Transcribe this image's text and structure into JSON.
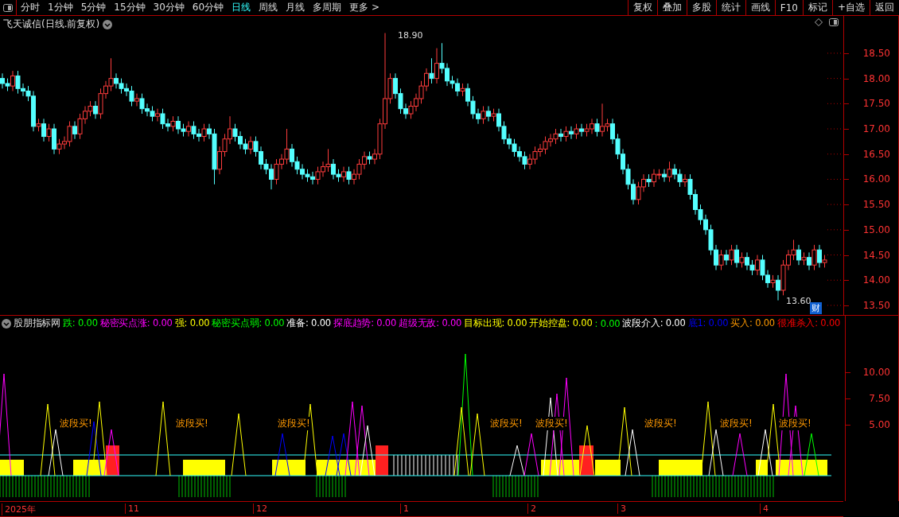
{
  "toolbar": {
    "periods": [
      {
        "label": "分时",
        "selected": false
      },
      {
        "label": "1分钟",
        "selected": false
      },
      {
        "label": "5分钟",
        "selected": false
      },
      {
        "label": "15分钟",
        "selected": false
      },
      {
        "label": "30分钟",
        "selected": false
      },
      {
        "label": "60分钟",
        "selected": false
      },
      {
        "label": "日线",
        "selected": true
      },
      {
        "label": "周线",
        "selected": false
      },
      {
        "label": "月线",
        "selected": false
      },
      {
        "label": "多周期",
        "selected": false
      },
      {
        "label": "更多 >",
        "selected": false
      }
    ],
    "actions": [
      "复权",
      "叠加",
      "多股",
      "统计",
      "画线",
      "F10",
      "标记",
      "+自选",
      "返回"
    ]
  },
  "price_chart": {
    "title": "飞天诚信(日线.前复权)",
    "high_label": "18.90",
    "low_label": "13.60",
    "badge": "财",
    "chart_data": {
      "type": "candlestick",
      "ylim": [
        13.31,
        19.24
      ],
      "yticks": [
        {
          "value": 18.5,
          "label": "18.50"
        },
        {
          "value": 18,
          "label": "18.00"
        },
        {
          "value": 17.5,
          "label": "17.50"
        },
        {
          "value": 17,
          "label": "17.00"
        },
        {
          "value": 16.5,
          "label": "16.50"
        },
        {
          "value": 16,
          "label": "16.00"
        },
        {
          "value": 15.5,
          "label": "15.50"
        },
        {
          "value": 15,
          "label": "15.00"
        },
        {
          "value": 14.5,
          "label": "14.50"
        },
        {
          "value": 14,
          "label": "14.00"
        },
        {
          "value": 13.5,
          "label": "13.50"
        }
      ],
      "categories": [
        null,
        null,
        null,
        null,
        null,
        null,
        null,
        null,
        null,
        null,
        null,
        null,
        null,
        null,
        null,
        null,
        null,
        null,
        null,
        null,
        null,
        null,
        null,
        null,
        null,
        null,
        null,
        null,
        null,
        null,
        null,
        null,
        null,
        null,
        null,
        null,
        null,
        null,
        null,
        null,
        null,
        null,
        null,
        null,
        null,
        null,
        null,
        null,
        null,
        null,
        null,
        null,
        null,
        null,
        null,
        null,
        null,
        null,
        null,
        null,
        null,
        null,
        null,
        null,
        null,
        null,
        null,
        null,
        null,
        null,
        null,
        null,
        null,
        null,
        null,
        null,
        null,
        null,
        null,
        null,
        null,
        null,
        null,
        null,
        null,
        null,
        null,
        null,
        null,
        null,
        null,
        null,
        null,
        null,
        null,
        null,
        null,
        null,
        null,
        null,
        null,
        null,
        null,
        null,
        null,
        null,
        null,
        null,
        null,
        null,
        null,
        null,
        null,
        null,
        null,
        null,
        null,
        null,
        null,
        null,
        null,
        null,
        null,
        null,
        null,
        null,
        null,
        null,
        null,
        null,
        null,
        null,
        null,
        null,
        null,
        null,
        null,
        null,
        null,
        null,
        null,
        null,
        null,
        null,
        null,
        null,
        null,
        null,
        null,
        null,
        null,
        null,
        null,
        null,
        null,
        null,
        null,
        null,
        null,
        null
      ],
      "ohlc": [
        [
          18.0,
          18.1,
          17.8,
          17.9
        ],
        [
          17.9,
          18.0,
          17.75,
          17.85
        ],
        [
          17.85,
          18.15,
          17.75,
          18.05
        ],
        [
          18.05,
          18.15,
          17.7,
          17.8
        ],
        [
          17.8,
          17.9,
          17.65,
          17.75
        ],
        [
          17.75,
          17.85,
          17.55,
          17.65
        ],
        [
          17.65,
          17.75,
          16.95,
          17.05
        ],
        [
          17.05,
          17.2,
          16.95,
          17.1
        ],
        [
          17.1,
          17.2,
          16.75,
          16.85
        ],
        [
          16.85,
          17.1,
          16.75,
          17.0
        ],
        [
          17.0,
          17.1,
          16.5,
          16.6
        ],
        [
          16.6,
          16.8,
          16.5,
          16.7
        ],
        [
          16.7,
          16.85,
          16.6,
          16.75
        ],
        [
          16.75,
          17.15,
          16.65,
          17.05
        ],
        [
          17.05,
          17.15,
          16.8,
          16.9
        ],
        [
          16.9,
          17.3,
          16.8,
          17.2
        ],
        [
          17.2,
          17.45,
          17.1,
          17.35
        ],
        [
          17.35,
          17.55,
          17.25,
          17.45
        ],
        [
          17.45,
          17.55,
          17.2,
          17.3
        ],
        [
          17.3,
          17.8,
          17.2,
          17.7
        ],
        [
          17.7,
          17.95,
          17.6,
          17.85
        ],
        [
          17.85,
          18.4,
          17.75,
          18.0
        ],
        [
          18.0,
          18.1,
          17.8,
          17.9
        ],
        [
          17.9,
          18.0,
          17.7,
          17.8
        ],
        [
          17.8,
          17.9,
          17.65,
          17.75
        ],
        [
          17.75,
          17.85,
          17.45,
          17.55
        ],
        [
          17.55,
          17.7,
          17.45,
          17.6
        ],
        [
          17.6,
          17.7,
          17.3,
          17.4
        ],
        [
          17.4,
          17.5,
          17.25,
          17.35
        ],
        [
          17.35,
          17.45,
          17.15,
          17.25
        ],
        [
          17.25,
          17.4,
          17.15,
          17.3
        ],
        [
          17.3,
          17.4,
          17.0,
          17.1
        ],
        [
          17.1,
          17.2,
          16.95,
          17.05
        ],
        [
          17.05,
          17.25,
          16.95,
          17.15
        ],
        [
          17.15,
          17.25,
          16.9,
          17.0
        ],
        [
          17.0,
          17.1,
          16.85,
          16.95
        ],
        [
          16.95,
          17.15,
          16.85,
          17.05
        ],
        [
          17.05,
          17.15,
          16.8,
          16.9
        ],
        [
          16.9,
          17.0,
          16.75,
          16.85
        ],
        [
          16.85,
          17.1,
          16.75,
          17.0
        ],
        [
          17.0,
          17.1,
          16.8,
          16.9
        ],
        [
          16.9,
          17.0,
          15.9,
          16.2
        ],
        [
          16.2,
          16.65,
          16.1,
          16.55
        ],
        [
          16.55,
          16.9,
          16.45,
          16.8
        ],
        [
          16.8,
          17.25,
          16.7,
          17.0
        ],
        [
          17.0,
          17.1,
          16.75,
          16.85
        ],
        [
          16.85,
          16.95,
          16.6,
          16.7
        ],
        [
          16.7,
          16.8,
          16.5,
          16.6
        ],
        [
          16.6,
          16.85,
          16.5,
          16.75
        ],
        [
          16.75,
          16.85,
          16.45,
          16.55
        ],
        [
          16.55,
          16.65,
          16.2,
          16.3
        ],
        [
          16.3,
          16.4,
          16.1,
          16.2
        ],
        [
          16.2,
          16.3,
          15.8,
          16.0
        ],
        [
          16.0,
          16.4,
          15.9,
          16.3
        ],
        [
          16.3,
          16.5,
          16.2,
          16.4
        ],
        [
          16.4,
          17.0,
          16.3,
          16.6
        ],
        [
          16.6,
          16.7,
          16.25,
          16.35
        ],
        [
          16.35,
          16.45,
          16.1,
          16.2
        ],
        [
          16.2,
          16.3,
          16.0,
          16.1
        ],
        [
          16.1,
          16.2,
          15.95,
          16.05
        ],
        [
          16.05,
          16.15,
          15.9,
          16.0
        ],
        [
          16.0,
          16.25,
          15.9,
          16.15
        ],
        [
          16.15,
          16.35,
          16.05,
          16.25
        ],
        [
          16.25,
          16.6,
          16.15,
          16.3
        ],
        [
          16.3,
          16.4,
          16.0,
          16.1
        ],
        [
          16.1,
          16.2,
          15.95,
          16.05
        ],
        [
          16.05,
          16.25,
          15.95,
          16.15
        ],
        [
          16.15,
          16.25,
          15.9,
          16.0
        ],
        [
          16.0,
          16.2,
          15.9,
          16.1
        ],
        [
          16.1,
          16.4,
          16.0,
          16.3
        ],
        [
          16.3,
          16.55,
          16.2,
          16.45
        ],
        [
          16.45,
          16.55,
          16.3,
          16.4
        ],
        [
          16.4,
          16.6,
          16.3,
          16.5
        ],
        [
          16.5,
          17.2,
          16.4,
          17.1
        ],
        [
          17.1,
          18.9,
          17.0,
          17.6
        ],
        [
          17.6,
          18.1,
          17.5,
          18.0
        ],
        [
          18.0,
          18.1,
          17.6,
          17.7
        ],
        [
          17.7,
          17.8,
          17.3,
          17.4
        ],
        [
          17.4,
          17.5,
          17.2,
          17.3
        ],
        [
          17.3,
          17.55,
          17.2,
          17.45
        ],
        [
          17.45,
          17.7,
          17.35,
          17.6
        ],
        [
          17.6,
          17.95,
          17.5,
          17.85
        ],
        [
          17.85,
          18.2,
          17.75,
          18.1
        ],
        [
          18.1,
          18.4,
          17.9,
          18.0
        ],
        [
          18.0,
          18.6,
          17.9,
          18.3
        ],
        [
          18.3,
          18.7,
          18.1,
          18.2
        ],
        [
          18.2,
          18.3,
          17.85,
          17.95
        ],
        [
          17.95,
          18.05,
          17.8,
          17.9
        ],
        [
          17.9,
          18.0,
          17.65,
          17.75
        ],
        [
          17.75,
          17.9,
          17.65,
          17.8
        ],
        [
          17.8,
          17.9,
          17.45,
          17.55
        ],
        [
          17.55,
          17.65,
          17.2,
          17.3
        ],
        [
          17.3,
          17.4,
          17.1,
          17.2
        ],
        [
          17.2,
          17.45,
          17.1,
          17.35
        ],
        [
          17.35,
          17.45,
          17.15,
          17.25
        ],
        [
          17.25,
          17.4,
          17.15,
          17.3
        ],
        [
          17.3,
          17.4,
          16.95,
          17.05
        ],
        [
          17.05,
          17.15,
          16.7,
          16.8
        ],
        [
          16.8,
          16.9,
          16.6,
          16.7
        ],
        [
          16.7,
          16.8,
          16.45,
          16.55
        ],
        [
          16.55,
          16.65,
          16.35,
          16.45
        ],
        [
          16.45,
          16.55,
          16.2,
          16.3
        ],
        [
          16.3,
          16.5,
          16.2,
          16.4
        ],
        [
          16.4,
          16.65,
          16.3,
          16.55
        ],
        [
          16.55,
          16.7,
          16.45,
          16.6
        ],
        [
          16.6,
          16.85,
          16.5,
          16.75
        ],
        [
          16.75,
          16.9,
          16.65,
          16.8
        ],
        [
          16.8,
          17.0,
          16.7,
          16.9
        ],
        [
          16.9,
          17.0,
          16.75,
          16.85
        ],
        [
          16.85,
          17.05,
          16.75,
          16.95
        ],
        [
          16.95,
          17.05,
          16.8,
          16.9
        ],
        [
          16.9,
          17.1,
          16.8,
          17.0
        ],
        [
          17.0,
          17.1,
          16.85,
          16.95
        ],
        [
          16.95,
          17.1,
          16.85,
          17.0
        ],
        [
          17.0,
          17.2,
          16.9,
          17.1
        ],
        [
          17.1,
          17.2,
          16.85,
          16.95
        ],
        [
          16.95,
          17.5,
          16.85,
          17.05
        ],
        [
          17.05,
          17.2,
          16.95,
          17.1
        ],
        [
          17.1,
          17.2,
          16.7,
          16.8
        ],
        [
          16.8,
          16.9,
          16.4,
          16.5
        ],
        [
          16.5,
          16.6,
          16.1,
          16.2
        ],
        [
          16.2,
          16.3,
          15.8,
          15.9
        ],
        [
          15.9,
          16.0,
          15.5,
          15.6
        ],
        [
          15.6,
          15.95,
          15.5,
          15.85
        ],
        [
          15.85,
          16.1,
          15.75,
          16.0
        ],
        [
          16.0,
          16.1,
          15.85,
          15.95
        ],
        [
          15.95,
          16.2,
          15.85,
          16.1
        ],
        [
          16.1,
          16.2,
          16.0,
          16.1
        ],
        [
          16.1,
          16.2,
          15.95,
          16.05
        ],
        [
          16.05,
          16.35,
          15.95,
          16.2
        ],
        [
          16.2,
          16.3,
          16.0,
          16.1
        ],
        [
          16.1,
          16.2,
          15.85,
          15.95
        ],
        [
          15.95,
          16.1,
          15.85,
          16.0
        ],
        [
          16.0,
          16.1,
          15.6,
          15.7
        ],
        [
          15.7,
          15.8,
          15.3,
          15.4
        ],
        [
          15.4,
          15.5,
          15.1,
          15.2
        ],
        [
          15.2,
          15.3,
          14.9,
          15.0
        ],
        [
          15.0,
          15.1,
          14.5,
          14.6
        ],
        [
          14.6,
          14.7,
          14.2,
          14.3
        ],
        [
          14.3,
          14.6,
          14.2,
          14.5
        ],
        [
          14.5,
          14.6,
          14.3,
          14.4
        ],
        [
          14.4,
          14.7,
          14.3,
          14.6
        ],
        [
          14.6,
          14.7,
          14.25,
          14.35
        ],
        [
          14.35,
          14.55,
          14.25,
          14.45
        ],
        [
          14.45,
          14.55,
          14.2,
          14.3
        ],
        [
          14.3,
          14.4,
          14.1,
          14.2
        ],
        [
          14.2,
          14.5,
          14.1,
          14.4
        ],
        [
          14.4,
          14.5,
          14.0,
          14.1
        ],
        [
          14.1,
          14.2,
          13.85,
          13.95
        ],
        [
          13.95,
          14.1,
          13.85,
          14.0
        ],
        [
          14.0,
          14.1,
          13.6,
          13.8
        ],
        [
          13.8,
          14.4,
          13.7,
          14.3
        ],
        [
          14.3,
          14.6,
          14.2,
          14.5
        ],
        [
          14.5,
          14.8,
          14.4,
          14.6
        ],
        [
          14.6,
          14.7,
          14.3,
          14.4
        ],
        [
          14.4,
          14.55,
          14.3,
          14.45
        ],
        [
          14.45,
          14.55,
          14.2,
          14.3
        ],
        [
          14.3,
          14.7,
          14.2,
          14.6
        ],
        [
          14.6,
          14.7,
          14.25,
          14.35
        ],
        [
          14.35,
          14.5,
          14.25,
          14.4
        ]
      ]
    }
  },
  "indicator": {
    "title": "股朋指标网",
    "legend": [
      {
        "text": "跌: 0.00",
        "color": "#00ff00"
      },
      {
        "text": "秘密买点涨: 0.00",
        "color": "#ff00ff"
      },
      {
        "text": "强: 0.00",
        "color": "#ffff00"
      },
      {
        "text": "秘密买点弱: 0.00",
        "color": "#00ff00"
      },
      {
        "text": "准备: 0.00",
        "color": "#ffffff"
      },
      {
        "text": "探底趋势: 0.00",
        "color": "#ff00ff"
      },
      {
        "text": "超级无敌: 0.00",
        "color": "#ff00ff"
      },
      {
        "text": "目标出现: 0.00",
        "color": "#ffff00"
      },
      {
        "text": "开始控盘: 0.00",
        "color": "#ffff00"
      },
      {
        "text": ": 0.00",
        "color": "#00ff00"
      },
      {
        "text": "波段介入: 0.00",
        "color": "#ffffff"
      },
      {
        "text": "底1: 0.00",
        "color": "#0000ff"
      },
      {
        "text": "买入: 0.00",
        "color": "#ff9900"
      },
      {
        "text": "很准杀入: 0.00",
        "color": "#ff0000"
      }
    ],
    "axis_labels": [
      "10.00",
      "7.50",
      "5.00"
    ],
    "signals": [
      "波段买!",
      "波段买!",
      "波段买!",
      "波段买!",
      "波段买!",
      "波段买!",
      "波段买!",
      "波段买!"
    ]
  },
  "date_axis": [
    "2025年",
    "11",
    "12",
    "1",
    "2",
    "3",
    "4"
  ]
}
